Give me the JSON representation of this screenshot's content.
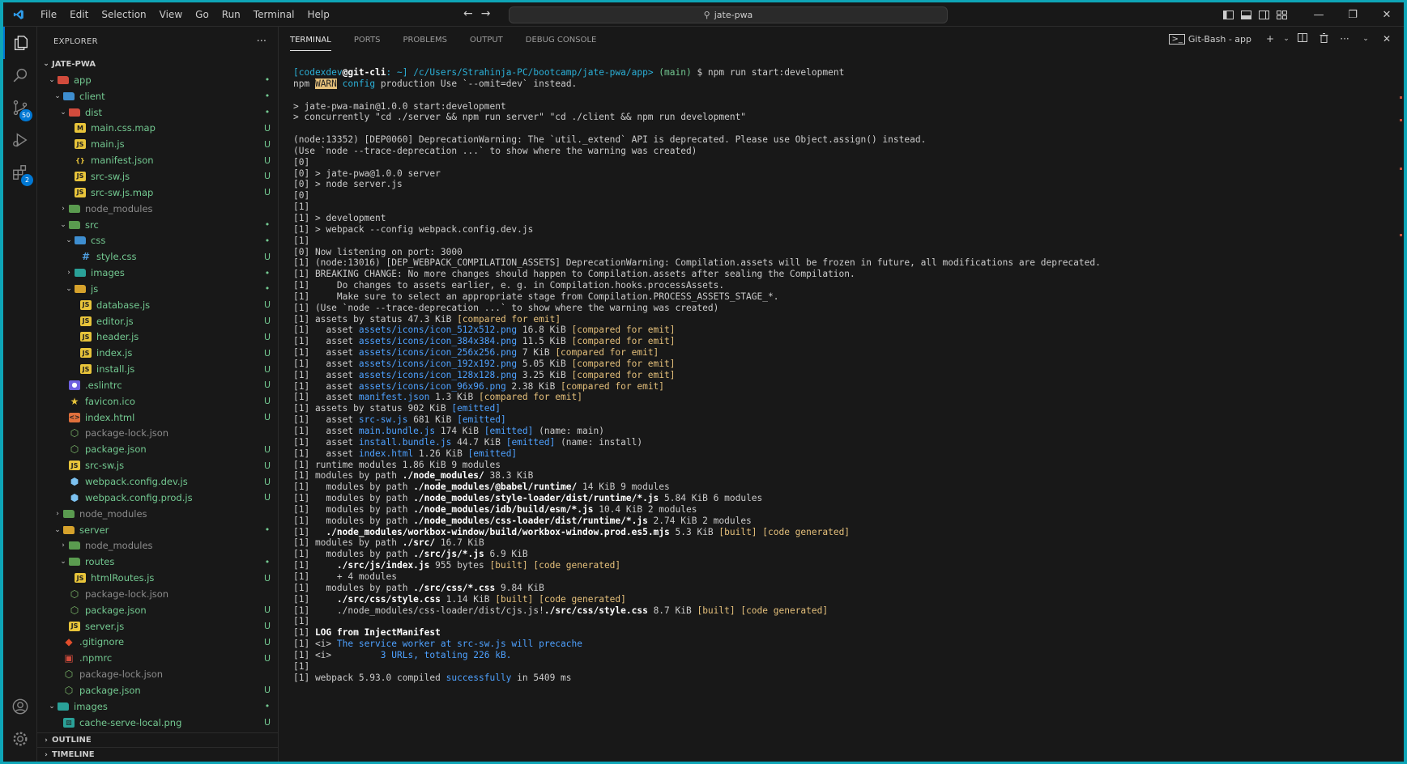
{
  "titlebar": {
    "menu": [
      "File",
      "Edit",
      "Selection",
      "View",
      "Go",
      "Run",
      "Terminal",
      "Help"
    ],
    "search_text": "jate-pwa"
  },
  "activity": {
    "scm_badge": "50",
    "extensions_badge": "2"
  },
  "explorer": {
    "title": "EXPLORER",
    "root": "JATE-PWA",
    "items": [
      {
        "name": "app",
        "depth": 1,
        "type": "folder",
        "open": true,
        "icon": "folder-red",
        "status": "•",
        "color": "green"
      },
      {
        "name": "client",
        "depth": 2,
        "type": "folder",
        "open": true,
        "icon": "folder-blue",
        "status": "•",
        "color": "green"
      },
      {
        "name": "dist",
        "depth": 3,
        "type": "folder",
        "open": true,
        "icon": "folder-red",
        "status": "•",
        "color": "green"
      },
      {
        "name": "main.css.map",
        "depth": 4,
        "type": "file",
        "icon": "map",
        "status": "U",
        "color": "green"
      },
      {
        "name": "main.js",
        "depth": 4,
        "type": "file",
        "icon": "js",
        "status": "U",
        "color": "green"
      },
      {
        "name": "manifest.json",
        "depth": 4,
        "type": "file",
        "icon": "json",
        "status": "U",
        "color": "green"
      },
      {
        "name": "src-sw.js",
        "depth": 4,
        "type": "file",
        "icon": "js",
        "status": "U",
        "color": "green"
      },
      {
        "name": "src-sw.js.map",
        "depth": 4,
        "type": "file",
        "icon": "js",
        "status": "U",
        "color": "green"
      },
      {
        "name": "node_modules",
        "depth": 3,
        "type": "folder",
        "open": false,
        "icon": "folder-green",
        "status": "",
        "color": "gray"
      },
      {
        "name": "src",
        "depth": 3,
        "type": "folder",
        "open": true,
        "icon": "folder-green",
        "status": "•",
        "color": "green"
      },
      {
        "name": "css",
        "depth": 4,
        "type": "folder",
        "open": true,
        "icon": "folder-blue",
        "status": "•",
        "color": "green"
      },
      {
        "name": "style.css",
        "depth": 5,
        "type": "file",
        "icon": "css",
        "status": "U",
        "color": "green"
      },
      {
        "name": "images",
        "depth": 4,
        "type": "folder",
        "open": false,
        "icon": "folder-teal",
        "status": "•",
        "color": "green"
      },
      {
        "name": "js",
        "depth": 4,
        "type": "folder",
        "open": true,
        "icon": "folder-yellow",
        "status": "•",
        "color": "green"
      },
      {
        "name": "database.js",
        "depth": 5,
        "type": "file",
        "icon": "js",
        "status": "U",
        "color": "green"
      },
      {
        "name": "editor.js",
        "depth": 5,
        "type": "file",
        "icon": "js",
        "status": "U",
        "color": "green"
      },
      {
        "name": "header.js",
        "depth": 5,
        "type": "file",
        "icon": "js",
        "status": "U",
        "color": "green"
      },
      {
        "name": "index.js",
        "depth": 5,
        "type": "file",
        "icon": "js",
        "status": "U",
        "color": "green"
      },
      {
        "name": "install.js",
        "depth": 5,
        "type": "file",
        "icon": "js",
        "status": "U",
        "color": "green"
      },
      {
        "name": ".eslintrc",
        "depth": 3,
        "type": "file",
        "icon": "eslint",
        "status": "U",
        "color": "green"
      },
      {
        "name": "favicon.ico",
        "depth": 3,
        "type": "file",
        "icon": "star",
        "status": "U",
        "color": "green"
      },
      {
        "name": "index.html",
        "depth": 3,
        "type": "file",
        "icon": "html",
        "status": "U",
        "color": "green"
      },
      {
        "name": "package-lock.json",
        "depth": 3,
        "type": "file",
        "icon": "npm",
        "status": "",
        "color": "gray"
      },
      {
        "name": "package.json",
        "depth": 3,
        "type": "file",
        "icon": "npm",
        "status": "U",
        "color": "green"
      },
      {
        "name": "src-sw.js",
        "depth": 3,
        "type": "file",
        "icon": "js",
        "status": "U",
        "color": "green"
      },
      {
        "name": "webpack.config.dev.js",
        "depth": 3,
        "type": "file",
        "icon": "webpack",
        "status": "U",
        "color": "green"
      },
      {
        "name": "webpack.config.prod.js",
        "depth": 3,
        "type": "file",
        "icon": "webpack",
        "status": "U",
        "color": "green"
      },
      {
        "name": "node_modules",
        "depth": 2,
        "type": "folder",
        "open": false,
        "icon": "folder-green",
        "status": "",
        "color": "gray"
      },
      {
        "name": "server",
        "depth": 2,
        "type": "folder",
        "open": true,
        "icon": "folder-yellow",
        "status": "•",
        "color": "green"
      },
      {
        "name": "node_modules",
        "depth": 3,
        "type": "folder",
        "open": false,
        "icon": "folder-green",
        "status": "",
        "color": "gray"
      },
      {
        "name": "routes",
        "depth": 3,
        "type": "folder",
        "open": true,
        "icon": "folder-green",
        "status": "•",
        "color": "green"
      },
      {
        "name": "htmlRoutes.js",
        "depth": 4,
        "type": "file",
        "icon": "js",
        "status": "U",
        "color": "green"
      },
      {
        "name": "package-lock.json",
        "depth": 3,
        "type": "file",
        "icon": "npm",
        "status": "",
        "color": "gray"
      },
      {
        "name": "package.json",
        "depth": 3,
        "type": "file",
        "icon": "npm",
        "status": "U",
        "color": "green"
      },
      {
        "name": "server.js",
        "depth": 3,
        "type": "file",
        "icon": "js",
        "status": "U",
        "color": "green"
      },
      {
        "name": ".gitignore",
        "depth": 2,
        "type": "file",
        "icon": "git",
        "status": "U",
        "color": "green"
      },
      {
        "name": ".npmrc",
        "depth": 2,
        "type": "file",
        "icon": "npmrc",
        "status": "U",
        "color": "green"
      },
      {
        "name": "package-lock.json",
        "depth": 2,
        "type": "file",
        "icon": "npm",
        "status": "",
        "color": "gray"
      },
      {
        "name": "package.json",
        "depth": 2,
        "type": "file",
        "icon": "npm",
        "status": "U",
        "color": "green"
      },
      {
        "name": "images",
        "depth": 1,
        "type": "folder",
        "open": true,
        "icon": "folder-teal",
        "status": "•",
        "color": "green"
      },
      {
        "name": "cache-serve-local.png",
        "depth": 2,
        "type": "file",
        "icon": "png",
        "status": "U",
        "color": "green"
      }
    ],
    "outline": "OUTLINE",
    "timeline": "TIMELINE"
  },
  "panel": {
    "tabs": [
      "TERMINAL",
      "PORTS",
      "PROBLEMS",
      "OUTPUT",
      "DEBUG CONSOLE"
    ],
    "active_tab": "TERMINAL",
    "terminal_name": "Git-Bash - app"
  },
  "terminal_lines": [
    [
      [
        "c",
        "[codexdev"
      ],
      [
        "b",
        "@git-cli"
      ],
      [
        "c",
        ": ~] /c/Users/Strahinja-PC/bootcamp/jate-pwa/app> "
      ],
      [
        "g",
        "(main)"
      ],
      [
        "n",
        " $ npm run start:development"
      ]
    ],
    [
      [
        "n",
        "npm "
      ],
      [
        "w",
        "WARN"
      ],
      [
        "n",
        " "
      ],
      [
        "c",
        "config"
      ],
      [
        "n",
        " production Use `--omit=dev` instead."
      ]
    ],
    [
      [
        "n",
        ""
      ]
    ],
    [
      [
        "n",
        "> jate-pwa-main@1.0.0 start:development"
      ]
    ],
    [
      [
        "n",
        "> concurrently \"cd ./server && npm run server\" \"cd ./client && npm run development\""
      ]
    ],
    [
      [
        "n",
        ""
      ]
    ],
    [
      [
        "n",
        "(node:13352) [DEP0060] DeprecationWarning: The `util._extend` API is deprecated. Please use Object.assign() instead."
      ]
    ],
    [
      [
        "n",
        "(Use `node --trace-deprecation ...` to show where the warning was created)"
      ]
    ],
    [
      [
        "n",
        "[0]"
      ]
    ],
    [
      [
        "n",
        "[0] > jate-pwa@1.0.0 server"
      ]
    ],
    [
      [
        "n",
        "[0] > node server.js"
      ]
    ],
    [
      [
        "n",
        "[0]"
      ]
    ],
    [
      [
        "n",
        "[1]"
      ]
    ],
    [
      [
        "n",
        "[1] > development"
      ]
    ],
    [
      [
        "n",
        "[1] > webpack --config webpack.config.dev.js"
      ]
    ],
    [
      [
        "n",
        "[1]"
      ]
    ],
    [
      [
        "n",
        "[0] Now listening on port: 3000"
      ]
    ],
    [
      [
        "n",
        "[1] (node:13016) [DEP_WEBPACK_COMPILATION_ASSETS] DeprecationWarning: Compilation.assets will be frozen in future, all modifications are deprecated."
      ]
    ],
    [
      [
        "n",
        "[1] BREAKING CHANGE: No more changes should happen to Compilation.assets after sealing the Compilation."
      ]
    ],
    [
      [
        "n",
        "[1]     Do changes to assets earlier, e. g. in Compilation.hooks.processAssets."
      ]
    ],
    [
      [
        "n",
        "[1]     Make sure to select an appropriate stage from Compilation.PROCESS_ASSETS_STAGE_*."
      ]
    ],
    [
      [
        "n",
        "[1] (Use `node --trace-deprecation ...` to show where the warning was created)"
      ]
    ],
    [
      [
        "n",
        "[1] assets by status 47.3 KiB "
      ],
      [
        "y",
        "[compared for emit]"
      ]
    ],
    [
      [
        "n",
        "[1]   asset "
      ],
      [
        "u",
        "assets/icons/icon_512x512.png"
      ],
      [
        "n",
        " 16.8 KiB "
      ],
      [
        "y",
        "[compared for emit]"
      ]
    ],
    [
      [
        "n",
        "[1]   asset "
      ],
      [
        "u",
        "assets/icons/icon_384x384.png"
      ],
      [
        "n",
        " 11.5 KiB "
      ],
      [
        "y",
        "[compared for emit]"
      ]
    ],
    [
      [
        "n",
        "[1]   asset "
      ],
      [
        "u",
        "assets/icons/icon_256x256.png"
      ],
      [
        "n",
        " 7 KiB "
      ],
      [
        "y",
        "[compared for emit]"
      ]
    ],
    [
      [
        "n",
        "[1]   asset "
      ],
      [
        "u",
        "assets/icons/icon_192x192.png"
      ],
      [
        "n",
        " 5.05 KiB "
      ],
      [
        "y",
        "[compared for emit]"
      ]
    ],
    [
      [
        "n",
        "[1]   asset "
      ],
      [
        "u",
        "assets/icons/icon_128x128.png"
      ],
      [
        "n",
        " 3.25 KiB "
      ],
      [
        "y",
        "[compared for emit]"
      ]
    ],
    [
      [
        "n",
        "[1]   asset "
      ],
      [
        "u",
        "assets/icons/icon_96x96.png"
      ],
      [
        "n",
        " 2.38 KiB "
      ],
      [
        "y",
        "[compared for emit]"
      ]
    ],
    [
      [
        "n",
        "[1]   asset "
      ],
      [
        "u",
        "manifest.json"
      ],
      [
        "n",
        " 1.3 KiB "
      ],
      [
        "y",
        "[compared for emit]"
      ]
    ],
    [
      [
        "n",
        "[1] assets by status 902 KiB "
      ],
      [
        "u",
        "[emitted]"
      ]
    ],
    [
      [
        "n",
        "[1]   asset "
      ],
      [
        "u",
        "src-sw.js"
      ],
      [
        "n",
        " 681 KiB "
      ],
      [
        "u",
        "[emitted]"
      ]
    ],
    [
      [
        "n",
        "[1]   asset "
      ],
      [
        "u",
        "main.bundle.js"
      ],
      [
        "n",
        " 174 KiB "
      ],
      [
        "u",
        "[emitted]"
      ],
      [
        "n",
        " (name: main)"
      ]
    ],
    [
      [
        "n",
        "[1]   asset "
      ],
      [
        "u",
        "install.bundle.js"
      ],
      [
        "n",
        " 44.7 KiB "
      ],
      [
        "u",
        "[emitted]"
      ],
      [
        "n",
        " (name: install)"
      ]
    ],
    [
      [
        "n",
        "[1]   asset "
      ],
      [
        "u",
        "index.html"
      ],
      [
        "n",
        " 1.26 KiB "
      ],
      [
        "u",
        "[emitted]"
      ]
    ],
    [
      [
        "n",
        "[1] runtime modules 1.86 KiB 9 modules"
      ]
    ],
    [
      [
        "n",
        "[1] modules by path "
      ],
      [
        "b",
        "./node_modules/"
      ],
      [
        "n",
        " 38.3 KiB"
      ]
    ],
    [
      [
        "n",
        "[1]   modules by path "
      ],
      [
        "b",
        "./node_modules/@babel/runtime/"
      ],
      [
        "n",
        " 14 KiB 9 modules"
      ]
    ],
    [
      [
        "n",
        "[1]   modules by path "
      ],
      [
        "b",
        "./node_modules/style-loader/dist/runtime/*.js"
      ],
      [
        "n",
        " 5.84 KiB 6 modules"
      ]
    ],
    [
      [
        "n",
        "[1]   modules by path "
      ],
      [
        "b",
        "./node_modules/idb/build/esm/*.js"
      ],
      [
        "n",
        " 10.4 KiB 2 modules"
      ]
    ],
    [
      [
        "n",
        "[1]   modules by path "
      ],
      [
        "b",
        "./node_modules/css-loader/dist/runtime/*.js"
      ],
      [
        "n",
        " 2.74 KiB 2 modules"
      ]
    ],
    [
      [
        "n",
        "[1]   "
      ],
      [
        "b",
        "./node_modules/workbox-window/build/workbox-window.prod.es5.mjs"
      ],
      [
        "n",
        " 5.3 KiB "
      ],
      [
        "y",
        "[built] [code generated]"
      ]
    ],
    [
      [
        "n",
        "[1] modules by path "
      ],
      [
        "b",
        "./src/"
      ],
      [
        "n",
        " 16.7 KiB"
      ]
    ],
    [
      [
        "n",
        "[1]   modules by path "
      ],
      [
        "b",
        "./src/js/*.js"
      ],
      [
        "n",
        " 6.9 KiB"
      ]
    ],
    [
      [
        "n",
        "[1]     "
      ],
      [
        "b",
        "./src/js/index.js"
      ],
      [
        "n",
        " 955 bytes "
      ],
      [
        "y",
        "[built] [code generated]"
      ]
    ],
    [
      [
        "n",
        "[1]     + 4 modules"
      ]
    ],
    [
      [
        "n",
        "[1]   modules by path "
      ],
      [
        "b",
        "./src/css/*.css"
      ],
      [
        "n",
        " 9.84 KiB"
      ]
    ],
    [
      [
        "n",
        "[1]     "
      ],
      [
        "b",
        "./src/css/style.css"
      ],
      [
        "n",
        " 1.14 KiB "
      ],
      [
        "y",
        "[built] [code generated]"
      ]
    ],
    [
      [
        "n",
        "[1]     ./node_modules/css-loader/dist/cjs.js!"
      ],
      [
        "b",
        "./src/css/style.css"
      ],
      [
        "n",
        " 8.7 KiB "
      ],
      [
        "y",
        "[built] [code generated]"
      ]
    ],
    [
      [
        "n",
        "[1]"
      ]
    ],
    [
      [
        "n",
        "[1] "
      ],
      [
        "b",
        "LOG from InjectManifest"
      ]
    ],
    [
      [
        "n",
        "[1] <i> "
      ],
      [
        "u",
        "The service worker at src-sw.js will precache"
      ]
    ],
    [
      [
        "n",
        "[1] <i>         "
      ],
      [
        "u",
        "3 URLs, totaling 226 kB."
      ]
    ],
    [
      [
        "n",
        "[1]"
      ]
    ],
    [
      [
        "n",
        "[1] webpack 5.93.0 compiled "
      ],
      [
        "u",
        "successfully"
      ],
      [
        "n",
        " in 5409 ms"
      ]
    ]
  ]
}
